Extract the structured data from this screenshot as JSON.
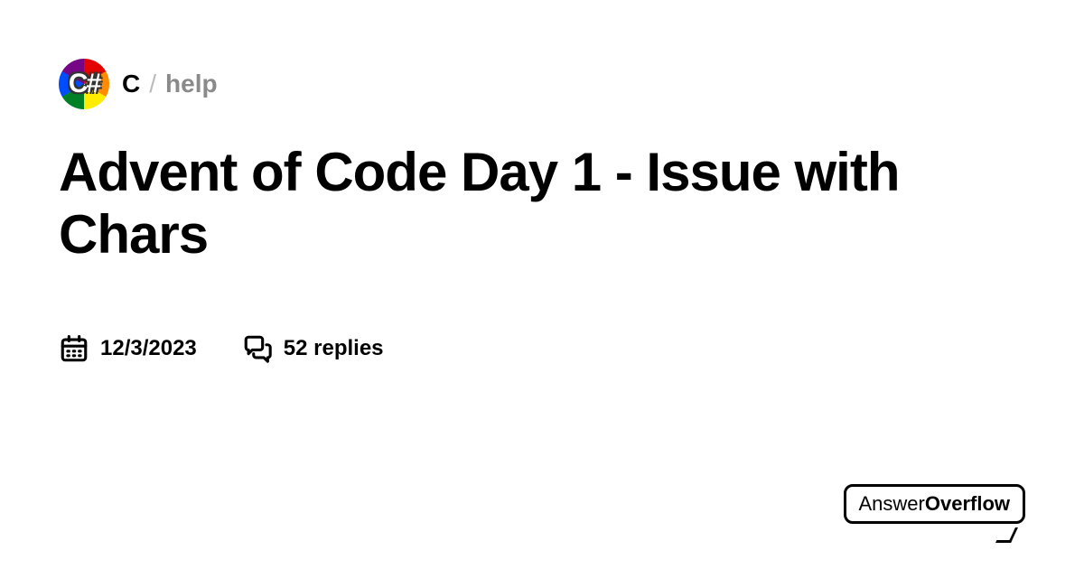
{
  "breadcrumb": {
    "server": "C",
    "separator": "/",
    "channel": "help"
  },
  "title": "Advent of Code Day 1 - Issue with Chars",
  "meta": {
    "date": "12/3/2023",
    "replies": "52 replies"
  },
  "brand": {
    "part1": "Answer",
    "part2": "Overflow"
  }
}
